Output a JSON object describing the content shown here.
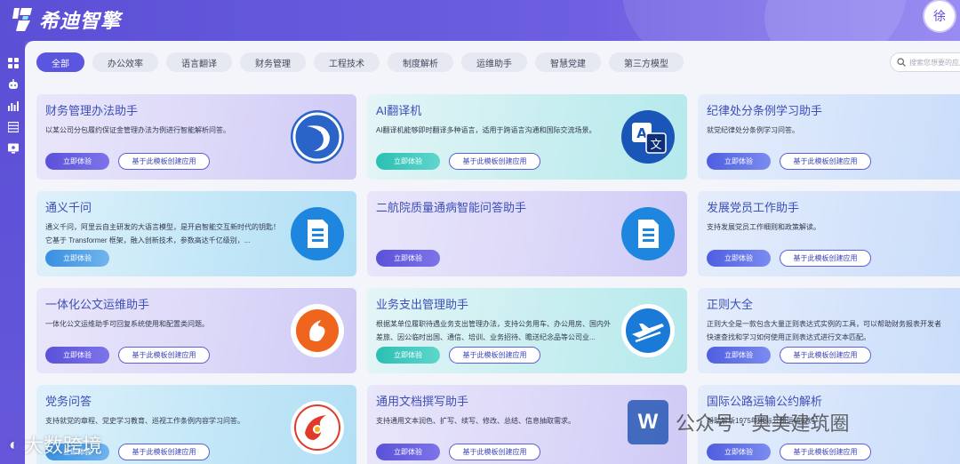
{
  "app": {
    "logo_text": "希迪智擎",
    "user_avatar": "徐"
  },
  "rail": {
    "icons": [
      "grid-icon",
      "robot-icon",
      "chart-icon",
      "list-icon",
      "monitor-icon"
    ]
  },
  "filters": {
    "items": [
      "全部",
      "办公效率",
      "语言翻译",
      "财务管理",
      "工程技术",
      "制度解析",
      "运维助手",
      "智慧党建",
      "第三方模型"
    ],
    "active": "全部"
  },
  "search": {
    "placeholder": "搜索您想要的应用"
  },
  "buttons": {
    "try": "立即体验",
    "template": "基于此模板创建应用"
  },
  "cards": [
    {
      "title": "财务管理办法助手",
      "desc": "以某公司分包履约保证金管理办法为例进行智能解析问答。",
      "icon": "spiral-logo-icon",
      "style": "lav",
      "has_template": true
    },
    {
      "title": "AI翻译机",
      "desc": "AI翻译机能够即时翻译多种语言，适用于跨语言沟通和国际交流场景。",
      "icon": "translate-icon",
      "style": "cyan",
      "has_template": true
    },
    {
      "title": "纪律处分条例学习助手",
      "desc": "就党纪律处分条例学习问答。",
      "icon": "",
      "style": "blue",
      "has_template": true
    },
    {
      "title": "通义千问",
      "desc": "通义千问，阿里云自主研发的大语言模型，是开启智能交互新时代的钥匙！它基于 Transformer 框架，融入创新技术，参数高达千亿级别，...",
      "icon": "document-icon",
      "style": "sky",
      "has_template": false
    },
    {
      "title": "二航院质量通病智能问答助手",
      "desc": "",
      "icon": "document-icon",
      "style": "lav",
      "has_template": false
    },
    {
      "title": "发展党员工作助手",
      "desc": "支持发展党员工作细则和政策解读。",
      "icon": "",
      "style": "blue",
      "has_template": true
    },
    {
      "title": "一体化公文运维助手",
      "desc": "一体化公文运维助手可回复系统使用和配置类问题。",
      "icon": "phoenix-icon",
      "style": "lav",
      "has_template": true
    },
    {
      "title": "业务支出管理助手",
      "desc": "根据某单位履职待遇业务支出管理办法，支持公务用车、办公用房、国内外差旅、因公临时出国、通信、培训、业务招待、瞻送纪念品等公司业...",
      "icon": "airplane-icon",
      "style": "cyan",
      "has_template": true
    },
    {
      "title": "正则大全",
      "desc": "正则大全是一款包含大量正则表达式实例的工具，可以帮助财务报表开发者快速查找和学习如何使用正则表达式进行文本匹配。",
      "icon": "",
      "style": "blue",
      "has_template": true
    },
    {
      "title": "党务问答",
      "desc": "支持就党的章程、党史学习教育、巡视工作条例内容学习问答。",
      "icon": "party-emblem-icon",
      "style": "sky",
      "has_template": true
    },
    {
      "title": "通用文档撰写助手",
      "desc": "支持通用文本润色、扩写、续写、修改、总结、信息抽取需求。",
      "icon": "",
      "style": "lav",
      "has_template": true
    },
    {
      "title": "国际公路运输公约解析",
      "desc": "帮助解析1975年国际公路运输公约",
      "icon": "",
      "style": "blue",
      "has_template": true
    }
  ],
  "watermarks": {
    "left": "大数跨境",
    "right_brand": "公众号 · 奥美建筑圈",
    "right_word_letter": "W"
  }
}
